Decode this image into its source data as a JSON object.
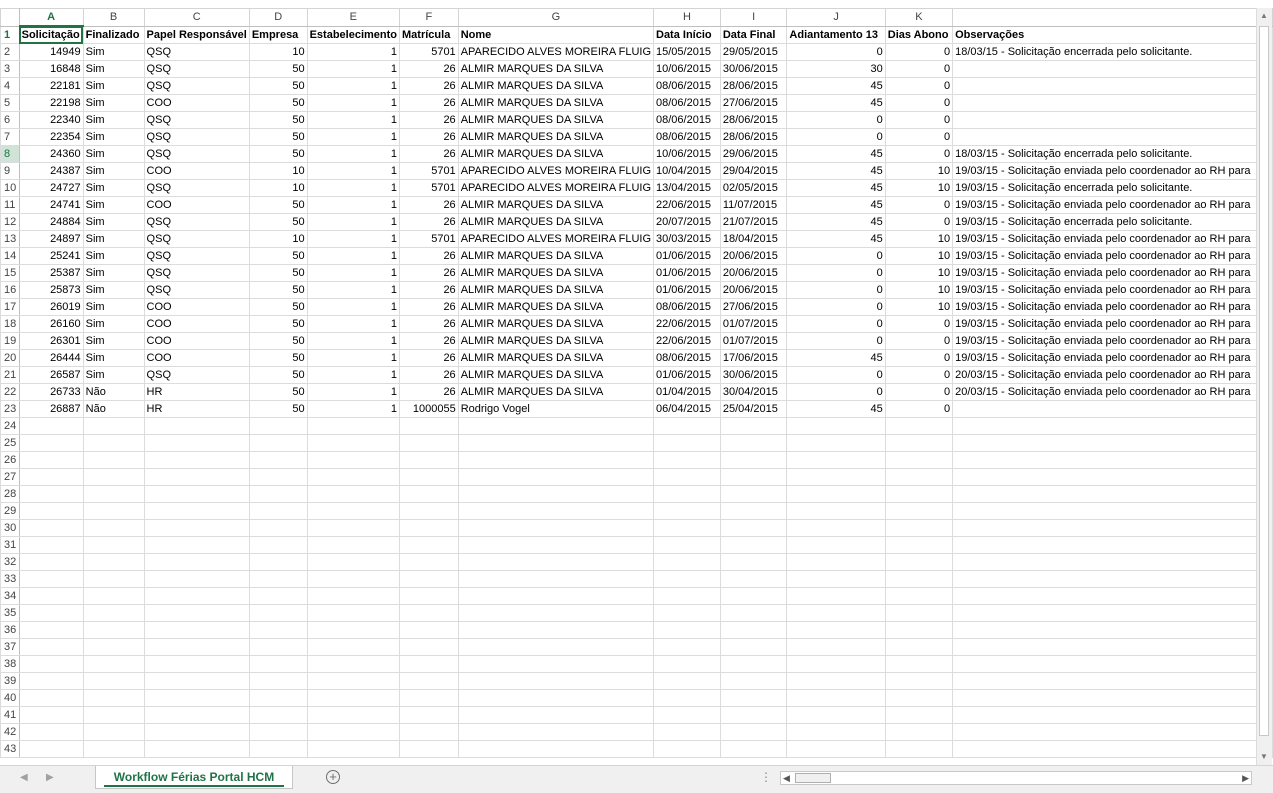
{
  "columns": [
    "A",
    "B",
    "C",
    "D",
    "E",
    "F",
    "G",
    "H",
    "I",
    "J",
    "K",
    ""
  ],
  "header": [
    "Solicitação",
    "Finalizado",
    "Papel Responsável",
    "Empresa",
    "Estabelecimento",
    "Matrícula",
    "Nome",
    "Data Início",
    "Data Final",
    "Adiantamento 13",
    "Dias Abono",
    "Observações"
  ],
  "rows": [
    [
      "14949",
      "Sim",
      "QSQ",
      "10",
      "1",
      "5701",
      "APARECIDO ALVES MOREIRA FLUIG",
      "15/05/2015",
      "29/05/2015",
      "0",
      "0",
      "18/03/15 - Solicitação encerrada pelo solicitante."
    ],
    [
      "16848",
      "Sim",
      "QSQ",
      "50",
      "1",
      "26",
      "ALMIR MARQUES DA SILVA",
      "10/06/2015",
      "30/06/2015",
      "30",
      "0",
      ""
    ],
    [
      "22181",
      "Sim",
      "QSQ",
      "50",
      "1",
      "26",
      "ALMIR MARQUES DA SILVA",
      "08/06/2015",
      "28/06/2015",
      "45",
      "0",
      ""
    ],
    [
      "22198",
      "Sim",
      "COO",
      "50",
      "1",
      "26",
      "ALMIR MARQUES DA SILVA",
      "08/06/2015",
      "27/06/2015",
      "45",
      "0",
      ""
    ],
    [
      "22340",
      "Sim",
      "QSQ",
      "50",
      "1",
      "26",
      "ALMIR MARQUES DA SILVA",
      "08/06/2015",
      "28/06/2015",
      "0",
      "0",
      ""
    ],
    [
      "22354",
      "Sim",
      "QSQ",
      "50",
      "1",
      "26",
      "ALMIR MARQUES DA SILVA",
      "08/06/2015",
      "28/06/2015",
      "0",
      "0",
      ""
    ],
    [
      "24360",
      "Sim",
      "QSQ",
      "50",
      "1",
      "26",
      "ALMIR MARQUES DA SILVA",
      "10/06/2015",
      "29/06/2015",
      "45",
      "0",
      "18/03/15 - Solicitação encerrada pelo solicitante."
    ],
    [
      "24387",
      "Sim",
      "COO",
      "10",
      "1",
      "5701",
      "APARECIDO ALVES MOREIRA FLUIG",
      "10/04/2015",
      "29/04/2015",
      "45",
      "10",
      "19/03/15 - Solicitação enviada pelo coordenador ao RH para"
    ],
    [
      "24727",
      "Sim",
      "QSQ",
      "10",
      "1",
      "5701",
      "APARECIDO ALVES MOREIRA FLUIG",
      "13/04/2015",
      "02/05/2015",
      "45",
      "10",
      "19/03/15 - Solicitação encerrada pelo solicitante."
    ],
    [
      "24741",
      "Sim",
      "COO",
      "50",
      "1",
      "26",
      "ALMIR MARQUES DA SILVA",
      "22/06/2015",
      "11/07/2015",
      "45",
      "0",
      "19/03/15 - Solicitação enviada pelo coordenador ao RH para"
    ],
    [
      "24884",
      "Sim",
      "QSQ",
      "50",
      "1",
      "26",
      "ALMIR MARQUES DA SILVA",
      "20/07/2015",
      "21/07/2015",
      "45",
      "0",
      "19/03/15 - Solicitação encerrada pelo solicitante."
    ],
    [
      "24897",
      "Sim",
      "QSQ",
      "10",
      "1",
      "5701",
      "APARECIDO ALVES MOREIRA FLUIG",
      "30/03/2015",
      "18/04/2015",
      "45",
      "10",
      "19/03/15 - Solicitação enviada pelo coordenador ao RH para"
    ],
    [
      "25241",
      "Sim",
      "QSQ",
      "50",
      "1",
      "26",
      "ALMIR MARQUES DA SILVA",
      "01/06/2015",
      "20/06/2015",
      "0",
      "10",
      "19/03/15 - Solicitação enviada pelo coordenador ao RH para"
    ],
    [
      "25387",
      "Sim",
      "QSQ",
      "50",
      "1",
      "26",
      "ALMIR MARQUES DA SILVA",
      "01/06/2015",
      "20/06/2015",
      "0",
      "10",
      "19/03/15 - Solicitação enviada pelo coordenador ao RH para"
    ],
    [
      "25873",
      "Sim",
      "QSQ",
      "50",
      "1",
      "26",
      "ALMIR MARQUES DA SILVA",
      "01/06/2015",
      "20/06/2015",
      "0",
      "10",
      "19/03/15 - Solicitação enviada pelo coordenador ao RH para"
    ],
    [
      "26019",
      "Sim",
      "COO",
      "50",
      "1",
      "26",
      "ALMIR MARQUES DA SILVA",
      "08/06/2015",
      "27/06/2015",
      "0",
      "10",
      "19/03/15 - Solicitação enviada pelo coordenador ao RH para"
    ],
    [
      "26160",
      "Sim",
      "COO",
      "50",
      "1",
      "26",
      "ALMIR MARQUES DA SILVA",
      "22/06/2015",
      "01/07/2015",
      "0",
      "0",
      "19/03/15 - Solicitação enviada pelo coordenador ao RH para"
    ],
    [
      "26301",
      "Sim",
      "COO",
      "50",
      "1",
      "26",
      "ALMIR MARQUES DA SILVA",
      "22/06/2015",
      "01/07/2015",
      "0",
      "0",
      "19/03/15 - Solicitação enviada pelo coordenador ao RH para"
    ],
    [
      "26444",
      "Sim",
      "COO",
      "50",
      "1",
      "26",
      "ALMIR MARQUES DA SILVA",
      "08/06/2015",
      "17/06/2015",
      "45",
      "0",
      "19/03/15 - Solicitação enviada pelo coordenador ao RH para"
    ],
    [
      "26587",
      "Sim",
      "QSQ",
      "50",
      "1",
      "26",
      "ALMIR MARQUES DA SILVA",
      "01/06/2015",
      "30/06/2015",
      "0",
      "0",
      "20/03/15 - Solicitação enviada pelo coordenador ao RH para"
    ],
    [
      "26733",
      "Não",
      "HR",
      "50",
      "1",
      "26",
      "ALMIR MARQUES DA SILVA",
      "01/04/2015",
      "30/04/2015",
      "0",
      "0",
      "20/03/15 - Solicitação enviada pelo coordenador ao RH para"
    ],
    [
      "26887",
      "Não",
      "HR",
      "50",
      "1",
      "1000055",
      "Rodrigo Vogel",
      "06/04/2015",
      "25/04/2015",
      "45",
      "0",
      ""
    ]
  ],
  "row_numbers": [
    "1",
    "2",
    "3",
    "4",
    "5",
    "6",
    "7",
    "8",
    "9",
    "10",
    "11",
    "12",
    "13",
    "14",
    "15",
    "16",
    "17",
    "18",
    "19",
    "20",
    "21",
    "22",
    "23",
    "24",
    "25",
    "26",
    "27",
    "28",
    "29",
    "30",
    "31",
    "32",
    "33",
    "34",
    "35",
    "36",
    "37",
    "38",
    "39",
    "40",
    "41",
    "42",
    "43"
  ],
  "selected_row": "8",
  "sheet_tab": "Workflow Férias Portal HCM",
  "colors": {
    "accent": "#217346",
    "gridline": "#dadcdd",
    "selected_row_header": "#cfe4d6"
  },
  "icons": [
    "nav-left-icon",
    "nav-right-icon",
    "add-sheet-icon",
    "scroll-up-icon",
    "scroll-down-icon",
    "scroll-left-icon",
    "scroll-right-icon"
  ]
}
